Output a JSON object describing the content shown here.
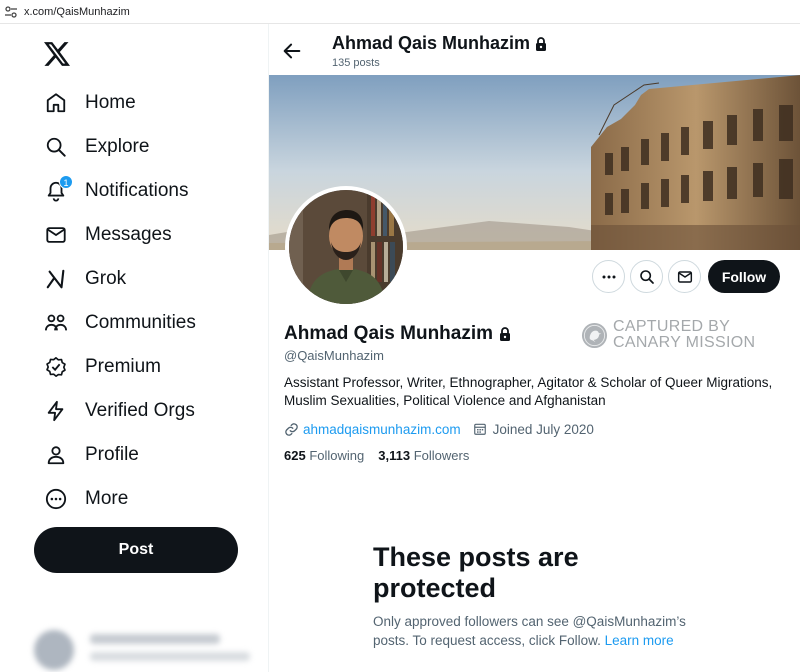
{
  "browser": {
    "url": "x.com/QaisMunhazim"
  },
  "nav": {
    "items": [
      {
        "label": "Home",
        "icon": "home-icon"
      },
      {
        "label": "Explore",
        "icon": "search-icon"
      },
      {
        "label": "Notifications",
        "icon": "bell-icon",
        "badge": "1"
      },
      {
        "label": "Messages",
        "icon": "envelope-icon"
      },
      {
        "label": "Grok",
        "icon": "grok-icon"
      },
      {
        "label": "Communities",
        "icon": "people-icon"
      },
      {
        "label": "Premium",
        "icon": "premium-icon"
      },
      {
        "label": "Verified Orgs",
        "icon": "lightning-icon"
      },
      {
        "label": "Profile",
        "icon": "person-icon"
      },
      {
        "label": "More",
        "icon": "more-circle-icon"
      }
    ],
    "post_label": "Post"
  },
  "header": {
    "name": "Ahmad Qais Munhazim",
    "posts_count": "135 posts"
  },
  "profile": {
    "name": "Ahmad Qais Munhazim",
    "handle": "@QaisMunhazim",
    "bio": "Assistant Professor, Writer, Ethnographer, Agitator & Scholar of Queer Migrations, Muslim Sexualities, Political Violence and Afghanistan",
    "website": "ahmadqaismunhazim.com",
    "joined": "Joined July 2020",
    "following_count": "625",
    "following_label": "Following",
    "followers_count": "3,113",
    "followers_label": "Followers",
    "follow_label": "Follow"
  },
  "watermark": {
    "line1": "CAPTURED BY",
    "line2": "CANARY MISSION"
  },
  "protected": {
    "title": "These posts are protected",
    "body": "Only approved followers can see @QaisMunhazim’s posts. To request access, click Follow.",
    "learn_more": "Learn more"
  },
  "colors": {
    "accent": "#1d9bf0",
    "text": "#0f1419",
    "secondary": "#536471",
    "button_dark": "#0f1419"
  }
}
